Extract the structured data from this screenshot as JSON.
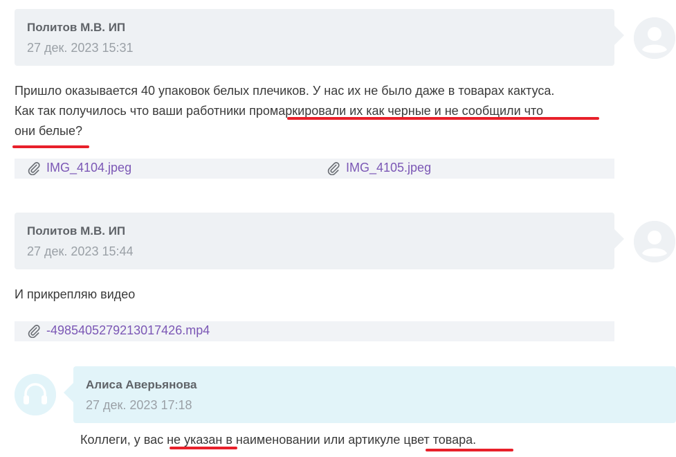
{
  "messages": [
    {
      "author": "Политов М.В. ИП",
      "date": "27 дек. 2023 15:31",
      "text_lines": [
        "Пришло оказывается 40 упаковок белых плечиков. У нас их не было даже в товарах кактуса.",
        "Как так получилось что ваши работники промаркировали их как черные и не сообщили что",
        "они белые?"
      ],
      "attachments": [
        "IMG_4104.jpeg",
        "IMG_4105.jpeg"
      ]
    },
    {
      "author": "Политов М.В. ИП",
      "date": "27 дек. 2023 15:44",
      "text": "И прикрепляю видео",
      "attachments": [
        "-4985405279213017426.mp4"
      ]
    },
    {
      "author": "Алиса Аверьянова",
      "date": "27 дек. 2023 17:18",
      "text": "Коллеги, у вас не указан в наименовании или артикуле цвет товара."
    }
  ],
  "icons": {
    "user_avatar": "user-circle-icon",
    "support_avatar": "headset-icon",
    "attachment": "paperclip-icon"
  },
  "colors": {
    "link": "#7b57b5",
    "highlight_underline": "#e8202a",
    "customer_card": "#eef1f4",
    "support_card": "#e2f4f9"
  }
}
